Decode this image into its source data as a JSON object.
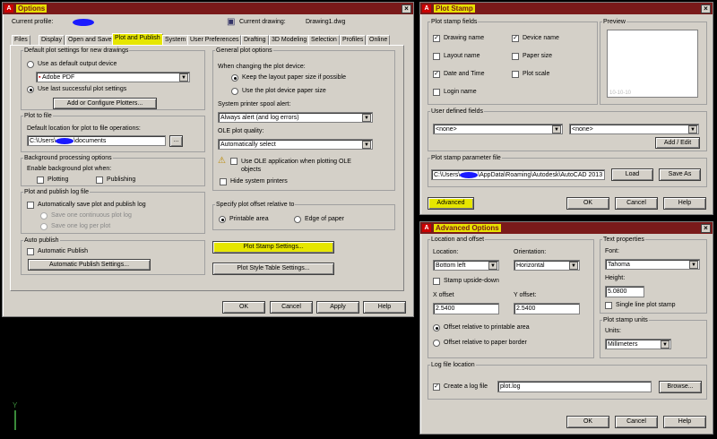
{
  "options": {
    "title": "Options",
    "current_profile_label": "Current profile:",
    "current_drawing_label": "Current drawing:",
    "current_drawing_value": "Drawing1.dwg",
    "tabs": [
      "Files",
      "Display",
      "Open and Save",
      "Plot and Publish",
      "System",
      "User Preferences",
      "Drafting",
      "3D Modeling",
      "Selection",
      "Profiles",
      "Online"
    ],
    "default_group": "Default plot settings for new drawings",
    "use_default_device": "Use as default output device",
    "device_value": "Adobe PDF",
    "use_last": "Use last successful plot settings",
    "add_plotters": "Add or Configure Plotters...",
    "plot_to_file_group": "Plot to file",
    "default_location": "Default location for plot to file operations:",
    "location_prefix": "C:\\Users\\",
    "location_suffix": "\\documents",
    "browse": "...",
    "bg_group": "Background processing options",
    "enable_bg": "Enable background plot when:",
    "plotting": "Plotting",
    "publishing": "Publishing",
    "log_group": "Plot and publish log file",
    "auto_save_log": "Automatically save plot and publish log",
    "save_one": "Save one continuous plot log",
    "save_per": "Save one log per plot",
    "auto_publish_group": "Auto publish",
    "auto_publish": "Automatic Publish",
    "auto_publish_settings": "Automatic Publish Settings...",
    "general_group": "General plot options",
    "when_changing": "When changing the plot device:",
    "keep_layout": "Keep the layout paper size if possible",
    "use_device_paper": "Use the plot device paper size",
    "spool_alert": "System printer spool alert:",
    "spool_value": "Always alert (and log errors)",
    "ole_quality": "OLE plot quality:",
    "ole_value": "Automatically select",
    "use_ole": "Use OLE application when plotting OLE objects",
    "hide_printers": "Hide system printers",
    "offset_group": "Specify plot offset relative to",
    "printable_area": "Printable area",
    "edge_paper": "Edge of paper",
    "stamp_settings": "Plot Stamp Settings...",
    "style_table": "Plot Style Table Settings...",
    "ok": "OK",
    "cancel": "Cancel",
    "apply": "Apply",
    "help": "Help"
  },
  "stamp": {
    "title": "Plot Stamp",
    "fields_group": "Plot stamp fields",
    "drawing_name": "Drawing name",
    "device_name": "Device name",
    "layout_name": "Layout name",
    "paper_size": "Paper size",
    "date_time": "Date and Time",
    "plot_scale": "Plot scale",
    "login_name": "Login name",
    "preview_group": "Preview",
    "preview_text": "10-10-10",
    "user_group": "User defined fields",
    "none1": "<none>",
    "none2": "<none>",
    "add_edit": "Add / Edit",
    "param_group": "Plot stamp parameter file",
    "param_prefix": "C:\\Users\\",
    "param_suffix": "\\AppData\\Roaming\\Autodesk\\AutoCAD 2013",
    "load": "Load",
    "save_as": "Save As",
    "advanced": "Advanced",
    "ok": "OK",
    "cancel": "Cancel",
    "help": "Help"
  },
  "adv": {
    "title": "Advanced Options",
    "loc_group": "Location and offset",
    "location_label": "Location:",
    "location_value": "Bottom left",
    "orientation_label": "Orientation:",
    "orientation_value": "Horizontal",
    "upside": "Stamp upside-down",
    "x_label": "X offset",
    "y_label": "Y offset:",
    "x_value": "2.5400",
    "y_value": "2.5400",
    "offset_printable": "Offset relative to printable area",
    "offset_border": "Offset relative to paper border",
    "text_group": "Text properties",
    "font_label": "Font:",
    "font_value": "Tahoma",
    "height_label": "Height:",
    "height_value": "5.0800",
    "single_line": "Single line plot stamp",
    "units_group": "Plot stamp units",
    "units_label": "Units:",
    "units_value": "Millimeters",
    "log_group": "Log file location",
    "create_log": "Create a log file",
    "log_value": "plot.log",
    "browse": "Browse...",
    "ok": "OK",
    "cancel": "Cancel",
    "help": "Help"
  },
  "ucs": {
    "y_label": "Y"
  }
}
